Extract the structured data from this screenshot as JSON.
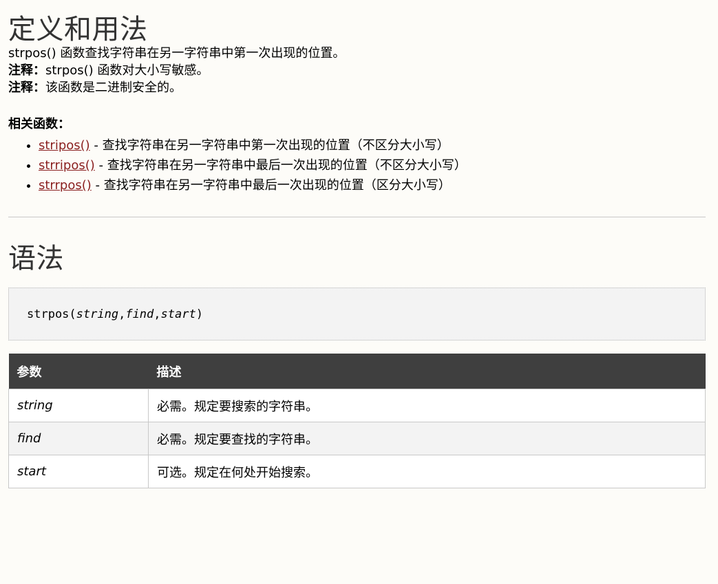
{
  "definition": {
    "heading": "定义和用法",
    "intro": "strpos() 函数查找字符串在另一字符串中第一次出现的位置。",
    "notes": [
      {
        "label": "注释：",
        "text": "strpos() 函数对大小写敏感。"
      },
      {
        "label": "注释：",
        "text": "该函数是二进制安全的。"
      }
    ],
    "related_title": "相关函数：",
    "related": [
      {
        "name": "stripos()",
        "desc": " - 查找字符串在另一字符串中第一次出现的位置（不区分大小写）"
      },
      {
        "name": "strripos()",
        "desc": " - 查找字符串在另一字符串中最后一次出现的位置（不区分大小写）"
      },
      {
        "name": "strrpos()",
        "desc": " - 查找字符串在另一字符串中最后一次出现的位置（区分大小写）"
      }
    ]
  },
  "syntax": {
    "heading": "语法",
    "code": {
      "func": "strpos(",
      "arg1": "string",
      "sep1": ",",
      "arg2": "find",
      "sep2": ",",
      "arg3": "start",
      "close": ")"
    }
  },
  "params_table": {
    "headers": [
      "参数",
      "描述"
    ],
    "rows": [
      {
        "name": "string",
        "desc": "必需。规定要搜索的字符串。"
      },
      {
        "name": "find",
        "desc": "必需。规定要查找的字符串。"
      },
      {
        "name": "start",
        "desc": "可选。规定在何处开始搜索。"
      }
    ]
  },
  "colors": {
    "link": "#8a1f1f",
    "table_header_bg": "#3f3f3f",
    "code_bg": "#f3f3f3",
    "page_bg": "#fdfcf8"
  }
}
